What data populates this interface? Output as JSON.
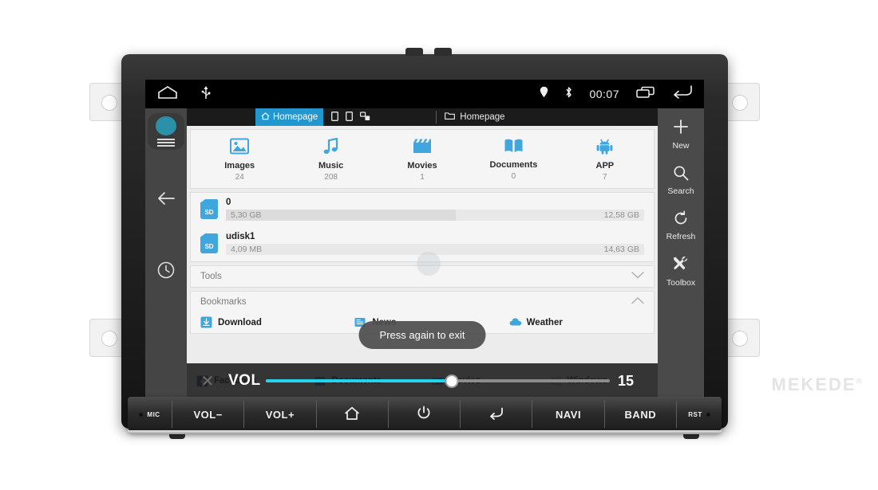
{
  "status_bar": {
    "home_icon": "home-outline-icon",
    "usb_icon": "usb-icon",
    "location_icon": "location-pin-icon",
    "bluetooth_icon": "bluetooth-icon",
    "time": "00:07",
    "recents_icon": "recents-icon",
    "back_icon": "back-arrow-icon"
  },
  "tab_bar": {
    "active_tab": "Homepage",
    "active_tab_icon": "home-icon",
    "tab_icons": [
      "device-icon",
      "device-icon",
      "network-device-icon"
    ],
    "path_label": "Homepage",
    "path_icon": "folder-icon"
  },
  "left_rail": {
    "avatar": "app-avatar",
    "menu_icon": "hamburger-icon",
    "back_icon": "back-arrow-icon",
    "history_icon": "clock-history-icon"
  },
  "categories": [
    {
      "label": "Images",
      "count": "24",
      "icon": "image-icon"
    },
    {
      "label": "Music",
      "count": "208",
      "icon": "music-note-icon"
    },
    {
      "label": "Movies",
      "count": "1",
      "icon": "clapperboard-icon"
    },
    {
      "label": "Documents",
      "count": "0",
      "icon": "book-icon"
    },
    {
      "label": "APP",
      "count": "7",
      "icon": "android-icon"
    }
  ],
  "storage": [
    {
      "name": "0",
      "used": "5,30 GB",
      "total": "12,58 GB",
      "percent": 55,
      "badge": "SD"
    },
    {
      "name": "udisk1",
      "used": "4,09 MB",
      "total": "14,63 GB",
      "percent": 0,
      "badge": "SD"
    }
  ],
  "sections": [
    {
      "label": "Tools",
      "state": "collapsed",
      "chevron": "chevron-down-icon"
    },
    {
      "label": "Bookmarks",
      "state": "expanded",
      "chevron": "chevron-up-icon"
    }
  ],
  "bookmarks_row1": [
    {
      "label": "Download",
      "icon": "download-icon"
    },
    {
      "label": "News",
      "icon": "news-icon"
    },
    {
      "label": "Weather",
      "icon": "weather-cloud-icon"
    }
  ],
  "bookmarks_row2": [
    {
      "label": "Facebook",
      "icon": "facebook-icon"
    },
    {
      "label": "Documents",
      "icon": "documents-icon"
    },
    {
      "label": "Movies",
      "icon": "movies-icon"
    },
    {
      "label": "Windows",
      "icon": "windows-icon"
    }
  ],
  "right_rail": [
    {
      "label": "New",
      "icon": "plus-icon"
    },
    {
      "label": "Search",
      "icon": "search-icon"
    },
    {
      "label": "Refresh",
      "icon": "refresh-icon"
    },
    {
      "label": "Toolbox",
      "icon": "toolbox-icon"
    }
  ],
  "toast": {
    "message": "Press again to exit"
  },
  "volume": {
    "label": "VOL",
    "value": "15",
    "percent": 54,
    "close_icon": "close-icon",
    "accent": "#22d3ee"
  },
  "hardware_buttons": [
    {
      "label": "MIC",
      "type": "mic"
    },
    {
      "label": "VOL−",
      "type": "text"
    },
    {
      "label": "VOL+",
      "type": "text"
    },
    {
      "label": "",
      "type": "home"
    },
    {
      "label": "",
      "type": "power"
    },
    {
      "label": "",
      "type": "back"
    },
    {
      "label": "NAVI",
      "type": "text"
    },
    {
      "label": "BAND",
      "type": "text"
    },
    {
      "label": "RST",
      "type": "reset"
    }
  ],
  "brand": {
    "watermark": "MEKEDE",
    "registered": "®"
  },
  "colors": {
    "accent_blue": "#2196cf",
    "icon_blue": "#3fa7dd",
    "slider_cyan": "#22d3ee",
    "bezel": "#1e1e1e"
  }
}
